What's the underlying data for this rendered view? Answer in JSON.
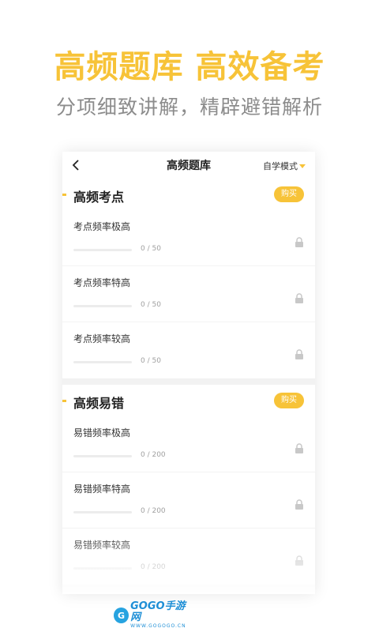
{
  "promo": {
    "title": "高频题库 高效备考",
    "subtitle": "分项细致讲解，精辟避错解析"
  },
  "screen": {
    "nav": {
      "back_icon": "chevron-left-icon",
      "back_glyph": "<",
      "title": "高频题库",
      "mode_label": "自学模式"
    },
    "sections": [
      {
        "title": "高频考点",
        "buy_label": "购买",
        "items": [
          {
            "title": "考点频率极高",
            "progress_text": "0 / 50",
            "progress": 0
          },
          {
            "title": "考点频率特高",
            "progress_text": "0 / 50",
            "progress": 0
          },
          {
            "title": "考点频率较高",
            "progress_text": "0 / 50",
            "progress": 0
          }
        ]
      },
      {
        "title": "高频易错",
        "buy_label": "购买",
        "items": [
          {
            "title": "易错频率极高",
            "progress_text": "0 / 200",
            "progress": 0
          },
          {
            "title": "易错频率特高",
            "progress_text": "0 / 200",
            "progress": 0
          },
          {
            "title": "易错频率较高",
            "progress_text": "0 / 200",
            "progress": 0
          }
        ]
      }
    ]
  },
  "watermark": {
    "brand": "GOGO手游网",
    "url": "WWW.GOGOGO.CN",
    "logo_glyph": "G"
  },
  "colors": {
    "accent": "#f7c338",
    "subtitle_gray": "#8c8c8c",
    "lock_gray": "#c8c8c8",
    "watermark_blue": "#1f8fd6"
  }
}
